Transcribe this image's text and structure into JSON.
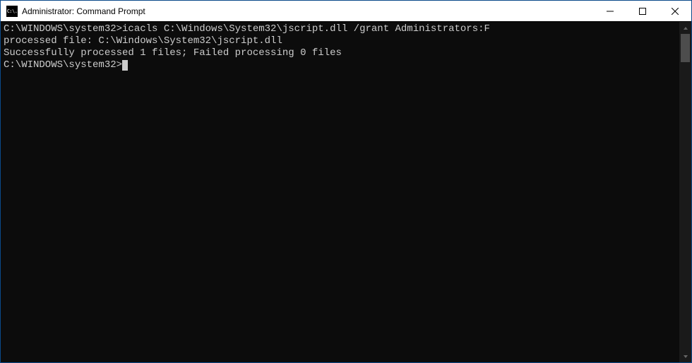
{
  "window": {
    "title": "Administrator: Command Prompt",
    "icon_glyph": "C:\\."
  },
  "console": {
    "lines": [
      "C:\\WINDOWS\\system32>icacls C:\\Windows\\System32\\jscript.dll /grant Administrators:F",
      "processed file: C:\\Windows\\System32\\jscript.dll",
      "Successfully processed 1 files; Failed processing 0 files",
      ""
    ],
    "prompt": "C:\\WINDOWS\\system32>",
    "current_input": ""
  },
  "controls": {
    "minimize": "Minimize",
    "maximize": "Maximize",
    "close": "Close"
  }
}
